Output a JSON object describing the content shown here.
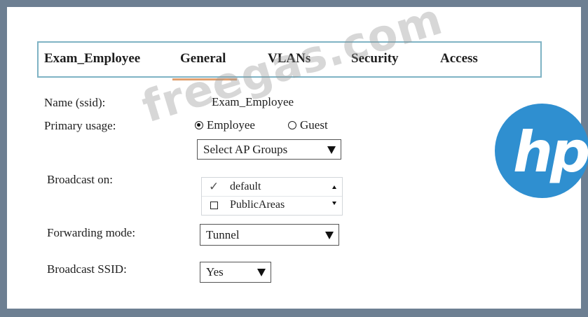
{
  "tabs": [
    {
      "label": "Exam_Employee"
    },
    {
      "label": "General"
    },
    {
      "label": "VLANs"
    },
    {
      "label": "Security"
    },
    {
      "label": "Access"
    }
  ],
  "form": {
    "name_label": "Name (ssid):",
    "name_value": "Exam_Employee",
    "usage_label": "Primary usage:",
    "usage_options": [
      "Employee",
      "Guest"
    ],
    "usage_selected": "Employee",
    "ap_groups_select": "Select AP Groups",
    "broadcast_on_label": "Broadcast on:",
    "broadcast_list": [
      {
        "label": "default",
        "checked": true
      },
      {
        "label": "PublicAreas",
        "checked": false
      }
    ],
    "forwarding_label": "Forwarding mode:",
    "forwarding_value": "Tunnel",
    "broadcast_ssid_label": "Broadcast SSID:",
    "broadcast_ssid_value": "Yes"
  },
  "watermark": "freegas.com",
  "logo": {
    "text": "hp",
    "color": "#2f8fd0"
  },
  "colors": {
    "background": "#6d7f92",
    "tab_border": "#7fb3c4",
    "tab_active_underline": "#e0a070"
  }
}
